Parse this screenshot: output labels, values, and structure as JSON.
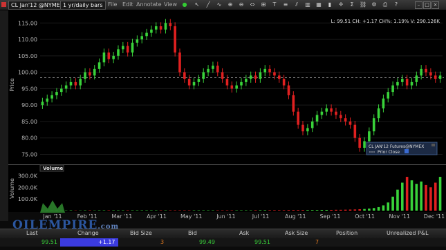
{
  "toolbar": {
    "symbol": "CL Jan'12 @NYMEX",
    "period": "1 yr/daily bars",
    "menus": [
      "File",
      "Edit",
      "Annotate",
      "View"
    ]
  },
  "chart": {
    "info": "L: 99.51 CH: +1.17 CH%: 1.19% V: 290.126K",
    "legend_title": "CL JAN'12 Futures@NYMEX",
    "legend_item": "Prior Close",
    "price_axis_label": "Price",
    "volume_axis_label": "Volume",
    "volume_title": "Volume",
    "prior_close": 98.34
  },
  "chart_data": {
    "type": "candlestick",
    "price_ticks": [
      "115.00",
      "110.00",
      "105.00",
      "100.00",
      "95.00",
      "90.00",
      "85.00",
      "80.00",
      "75.00"
    ],
    "price_ylim": [
      73,
      118
    ],
    "volume_ticks": [
      "300.0K",
      "200.0K",
      "100.0K"
    ],
    "volume_ylim": [
      0,
      320
    ],
    "months": [
      "Jan '11",
      "Feb '11",
      "Mar '11",
      "Apr '11",
      "May '11",
      "Jun '11",
      "Jul '11",
      "Aug '11",
      "Sep '11",
      "Oct '11",
      "Nov '11",
      "Dec '11"
    ],
    "closes": [
      91,
      92,
      93,
      94,
      95,
      96,
      97,
      96,
      98,
      100,
      99,
      101,
      103,
      106,
      104,
      105,
      107,
      108,
      106,
      109,
      110,
      111,
      112,
      113,
      114,
      113,
      115,
      114,
      106,
      100,
      98,
      96,
      97,
      98,
      100,
      101,
      102,
      100,
      98,
      96,
      95,
      96,
      97,
      98,
      99,
      98,
      100,
      101,
      100,
      99,
      98,
      96,
      93,
      88,
      84,
      82,
      83,
      85,
      87,
      88,
      89,
      88,
      87,
      86,
      85,
      84,
      80,
      77,
      79,
      82,
      86,
      89,
      92,
      94,
      96,
      97,
      98,
      96,
      97,
      99,
      101,
      100,
      99,
      98,
      99
    ],
    "volumes": [
      2,
      2,
      2,
      2,
      2,
      2,
      3,
      2,
      2,
      3,
      3,
      2,
      3,
      3,
      3,
      3,
      3,
      3,
      3,
      3,
      3,
      3,
      3,
      3,
      3,
      3,
      3,
      3,
      3,
      3,
      3,
      3,
      3,
      3,
      3,
      3,
      3,
      3,
      3,
      3,
      3,
      3,
      3,
      3,
      3,
      4,
      4,
      4,
      4,
      4,
      4,
      4,
      5,
      5,
      5,
      5,
      5,
      5,
      5,
      6,
      6,
      6,
      7,
      7,
      8,
      9,
      10,
      12,
      14,
      18,
      22,
      30,
      45,
      70,
      120,
      180,
      240,
      290,
      260,
      230,
      250,
      220,
      200,
      240,
      290
    ]
  },
  "quote_table": {
    "columns": [
      "Last",
      "Change",
      "Bid Size",
      "Bid",
      "Ask",
      "Ask Size",
      "Position",
      "Unrealized P&L"
    ],
    "values": [
      "99.51",
      "+1.17",
      "3",
      "99.49",
      "99.51",
      "7",
      "",
      ""
    ]
  },
  "watermark": {
    "brand": "OILEMPIRE",
    "suffix": ".com"
  },
  "colors": {
    "up": "#39d23a",
    "down": "#e02020",
    "change_bg": "#3b3be0",
    "last": "#39d23a",
    "size": "#e07a20"
  }
}
